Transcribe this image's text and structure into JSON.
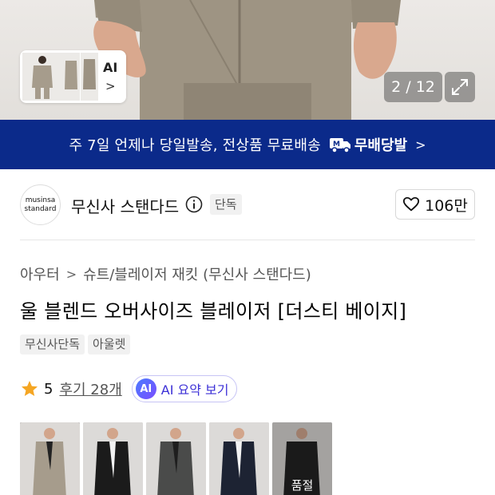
{
  "gallery": {
    "preview_label": "AI",
    "counter": "2 / 12",
    "icons": [
      "chevron-right-icon",
      "expand-icon"
    ]
  },
  "banner": {
    "message": "주 7일 언제나 당일발송, 전상품 무료배송",
    "brand": "무배당발",
    "colors": {
      "background": "#0b2a8a",
      "text": "#ffffff"
    }
  },
  "brand": {
    "logo_line1": "musinsa",
    "logo_line2": "standard",
    "name": "무신사 스탠다드",
    "badge": "단독",
    "likes": "106만"
  },
  "product": {
    "breadcrumb": [
      "아우터",
      "슈트/블레이저 재킷 (무신사 스탠다드)"
    ],
    "title": "울 블렌드 오버사이즈 블레이저 [더스티 베이지]",
    "tags": [
      "무신사단독",
      "아울렛"
    ],
    "rating": "5",
    "reviews": "후기 28개",
    "ai_summary_badge": "AI",
    "ai_summary": "AI 요약 보기"
  },
  "swatches": [
    {
      "color": "dusty-beige",
      "jacket": "#a69c8c",
      "selected": true
    },
    {
      "color": "black",
      "jacket": "#1b1b1b",
      "selected": false
    },
    {
      "color": "charcoal",
      "jacket": "#4a4b4a",
      "selected": false
    },
    {
      "color": "navy",
      "jacket": "#1d2333",
      "selected": false
    },
    {
      "color": "black-2",
      "jacket": "#202020",
      "selected": false,
      "label": "품절"
    }
  ],
  "colors": {
    "accent": "#0b2a8a",
    "star": "#f5a623",
    "ai": "#3b2fd6"
  }
}
